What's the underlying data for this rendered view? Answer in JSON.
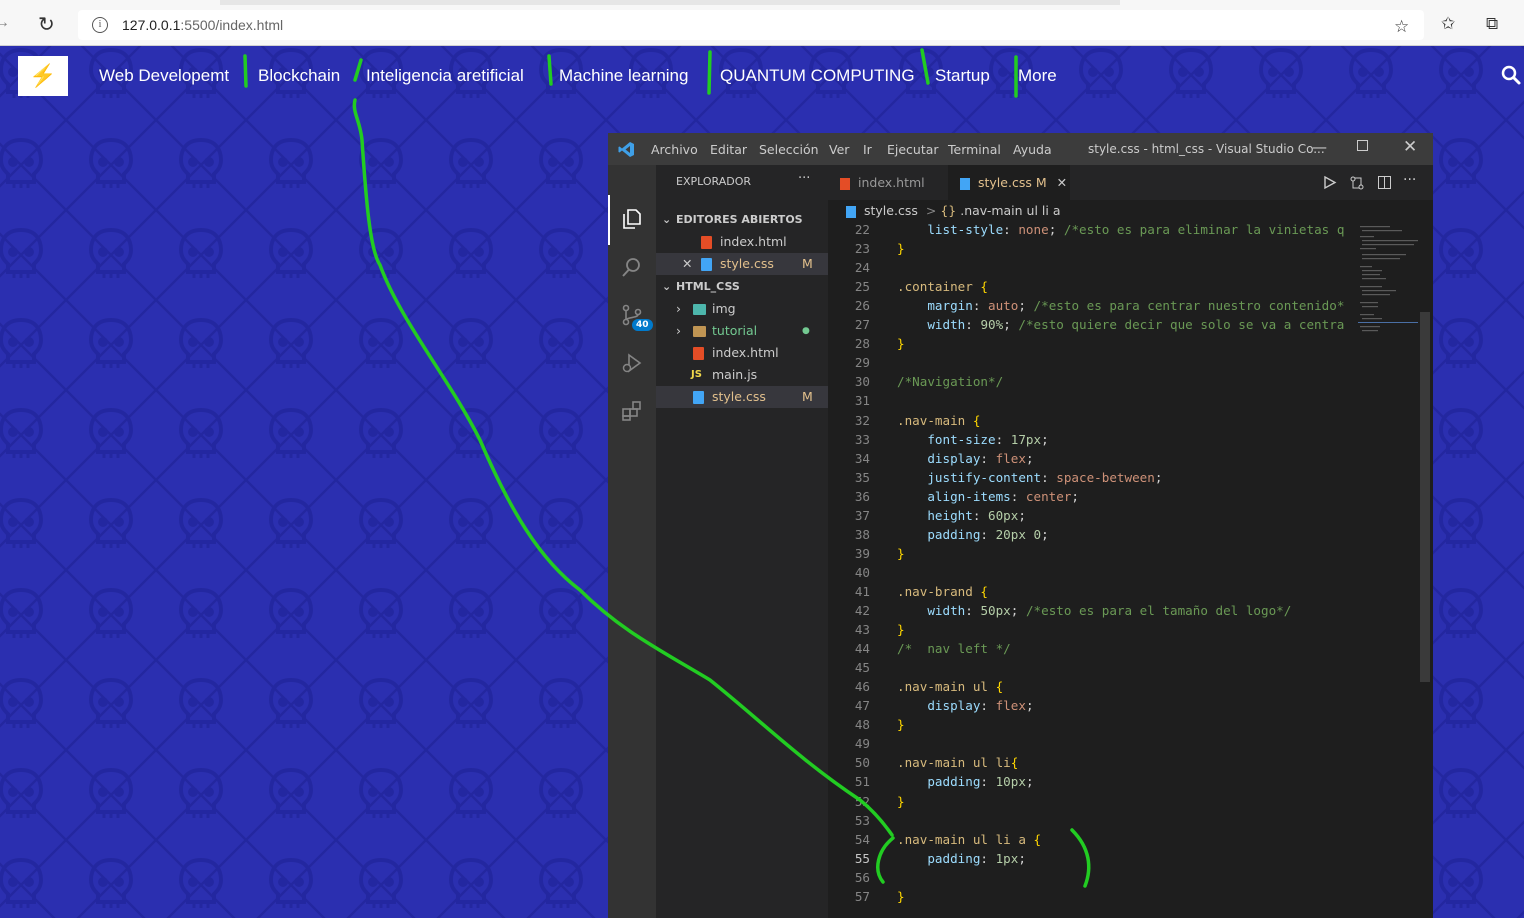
{
  "browser": {
    "url_host": "127.0.0.1",
    "url_rest": ":5500/index.html"
  },
  "site": {
    "logo_glyph": "⚡",
    "nav_links": [
      "Web Developemt",
      "Blockchain",
      "Inteligencia aretificial",
      "Machine learning",
      "QUANTUM COMPUTING",
      "Startup",
      "More"
    ],
    "background_color": "#2b2fb0",
    "pattern_color": "#2327a0"
  },
  "vscode": {
    "menu": [
      "Archivo",
      "Editar",
      "Selección",
      "Ver",
      "Ir",
      "Ejecutar",
      "Terminal",
      "Ayuda"
    ],
    "window_title": "style.css - html_css - Visual Studio Co...",
    "source_control_badge": "40",
    "explorer": {
      "title": "EXPLORADOR",
      "more": "···",
      "open_editors_title": "EDITORES ABIERTOS",
      "open_editors": [
        {
          "name": "index.html",
          "icon": "html-icon",
          "status": ""
        },
        {
          "name": "style.css",
          "icon": "css-icon",
          "status": "M"
        }
      ],
      "folder_title": "HTML_CSS",
      "files": [
        {
          "name": "img",
          "icon": "image-folder-icon",
          "status": "",
          "folder": true
        },
        {
          "name": "tutorial",
          "icon": "folder-icon",
          "status": "●",
          "folder": true
        },
        {
          "name": "index.html",
          "icon": "html-icon",
          "status": "",
          "folder": false
        },
        {
          "name": "main.js",
          "icon": "js-icon",
          "status": "",
          "folder": false
        },
        {
          "name": "style.css",
          "icon": "css-icon",
          "status": "M",
          "folder": false
        }
      ],
      "js_label": "JS"
    },
    "tabs": [
      {
        "name": "index.html",
        "modified": ""
      },
      {
        "name": "style.css",
        "modified": "M"
      }
    ],
    "close_glyph": "✕",
    "breadcrumb": {
      "file": "style.css",
      "separator": ">",
      "symbol": ".nav-main ul li a"
    },
    "code_lines": [
      {
        "n": "22",
        "tokens": [
          {
            "t": "    "
          },
          {
            "t": "list-style",
            "c": "prop"
          },
          {
            "t": ": "
          },
          {
            "t": "none",
            "c": "val"
          },
          {
            "t": "; "
          },
          {
            "t": "/*esto es para eliminar la vinietas q",
            "c": "cmt"
          }
        ]
      },
      {
        "n": "23",
        "tokens": [
          {
            "t": "}",
            "c": "br"
          }
        ]
      },
      {
        "n": "24",
        "tokens": []
      },
      {
        "n": "25",
        "tokens": [
          {
            "t": ".container",
            "c": "sel"
          },
          {
            "t": " "
          },
          {
            "t": "{",
            "c": "br"
          }
        ]
      },
      {
        "n": "26",
        "tokens": [
          {
            "t": "    "
          },
          {
            "t": "margin",
            "c": "prop"
          },
          {
            "t": ": "
          },
          {
            "t": "auto",
            "c": "val"
          },
          {
            "t": "; "
          },
          {
            "t": "/*esto es para centrar nuestro contenido*",
            "c": "cmt"
          }
        ]
      },
      {
        "n": "27",
        "tokens": [
          {
            "t": "    "
          },
          {
            "t": "width",
            "c": "prop"
          },
          {
            "t": ": "
          },
          {
            "t": "90%",
            "c": "num"
          },
          {
            "t": "; "
          },
          {
            "t": "/*esto quiere decir que solo se va a centra",
            "c": "cmt"
          }
        ]
      },
      {
        "n": "28",
        "tokens": [
          {
            "t": "}",
            "c": "br"
          }
        ]
      },
      {
        "n": "29",
        "tokens": []
      },
      {
        "n": "30",
        "tokens": [
          {
            "t": "/*Navigation*/",
            "c": "cmt"
          }
        ]
      },
      {
        "n": "31",
        "tokens": []
      },
      {
        "n": "32",
        "tokens": [
          {
            "t": ".nav-main",
            "c": "sel"
          },
          {
            "t": " "
          },
          {
            "t": "{",
            "c": "br"
          }
        ]
      },
      {
        "n": "33",
        "tokens": [
          {
            "t": "    "
          },
          {
            "t": "font-size",
            "c": "prop"
          },
          {
            "t": ": "
          },
          {
            "t": "17px",
            "c": "num"
          },
          {
            "t": ";"
          }
        ]
      },
      {
        "n": "34",
        "tokens": [
          {
            "t": "    "
          },
          {
            "t": "display",
            "c": "prop"
          },
          {
            "t": ": "
          },
          {
            "t": "flex",
            "c": "val"
          },
          {
            "t": ";"
          }
        ]
      },
      {
        "n": "35",
        "tokens": [
          {
            "t": "    "
          },
          {
            "t": "justify-content",
            "c": "prop"
          },
          {
            "t": ": "
          },
          {
            "t": "space-between",
            "c": "val"
          },
          {
            "t": ";"
          }
        ]
      },
      {
        "n": "36",
        "tokens": [
          {
            "t": "    "
          },
          {
            "t": "align-items",
            "c": "prop"
          },
          {
            "t": ": "
          },
          {
            "t": "center",
            "c": "val"
          },
          {
            "t": ";"
          }
        ]
      },
      {
        "n": "37",
        "tokens": [
          {
            "t": "    "
          },
          {
            "t": "height",
            "c": "prop"
          },
          {
            "t": ": "
          },
          {
            "t": "60px",
            "c": "num"
          },
          {
            "t": ";"
          }
        ]
      },
      {
        "n": "38",
        "tokens": [
          {
            "t": "    "
          },
          {
            "t": "padding",
            "c": "prop"
          },
          {
            "t": ": "
          },
          {
            "t": "20px 0",
            "c": "num"
          },
          {
            "t": ";"
          }
        ]
      },
      {
        "n": "39",
        "tokens": [
          {
            "t": "}",
            "c": "br"
          }
        ]
      },
      {
        "n": "40",
        "tokens": []
      },
      {
        "n": "41",
        "tokens": [
          {
            "t": ".nav-brand",
            "c": "sel"
          },
          {
            "t": " "
          },
          {
            "t": "{",
            "c": "br"
          }
        ]
      },
      {
        "n": "42",
        "tokens": [
          {
            "t": "    "
          },
          {
            "t": "width",
            "c": "prop"
          },
          {
            "t": ": "
          },
          {
            "t": "50px",
            "c": "num"
          },
          {
            "t": "; "
          },
          {
            "t": "/*esto es para el tamaño del logo*/",
            "c": "cmt"
          }
        ]
      },
      {
        "n": "43",
        "tokens": [
          {
            "t": "}",
            "c": "br"
          }
        ]
      },
      {
        "n": "44",
        "tokens": [
          {
            "t": "/*  nav left */",
            "c": "cmt"
          }
        ]
      },
      {
        "n": "45",
        "tokens": []
      },
      {
        "n": "46",
        "tokens": [
          {
            "t": ".nav-main ul",
            "c": "sel"
          },
          {
            "t": " "
          },
          {
            "t": "{",
            "c": "br"
          }
        ]
      },
      {
        "n": "47",
        "tokens": [
          {
            "t": "    "
          },
          {
            "t": "display",
            "c": "prop"
          },
          {
            "t": ": "
          },
          {
            "t": "flex",
            "c": "val"
          },
          {
            "t": ";"
          }
        ]
      },
      {
        "n": "48",
        "tokens": [
          {
            "t": "}",
            "c": "br"
          }
        ]
      },
      {
        "n": "49",
        "tokens": []
      },
      {
        "n": "50",
        "tokens": [
          {
            "t": ".nav-main ul li",
            "c": "sel"
          },
          {
            "t": "{",
            "c": "br"
          }
        ]
      },
      {
        "n": "51",
        "tokens": [
          {
            "t": "    "
          },
          {
            "t": "padding",
            "c": "prop"
          },
          {
            "t": ": "
          },
          {
            "t": "10px",
            "c": "num"
          },
          {
            "t": ";"
          }
        ]
      },
      {
        "n": "52",
        "tokens": [
          {
            "t": "}",
            "c": "br"
          }
        ]
      },
      {
        "n": "53",
        "tokens": []
      },
      {
        "n": "54",
        "tokens": [
          {
            "t": ".nav-main ul li a",
            "c": "sel"
          },
          {
            "t": " "
          },
          {
            "t": "{",
            "c": "br"
          }
        ]
      },
      {
        "n": "55",
        "tokens": [
          {
            "t": "    "
          },
          {
            "t": "padding",
            "c": "prop"
          },
          {
            "t": ": "
          },
          {
            "t": "1px",
            "c": "num"
          },
          {
            "t": ";"
          }
        ]
      },
      {
        "n": "56",
        "tokens": []
      },
      {
        "n": "57",
        "tokens": [
          {
            "t": "}",
            "c": "br"
          }
        ]
      }
    ],
    "current_line": "55"
  },
  "annotation_color": "#22cc22"
}
